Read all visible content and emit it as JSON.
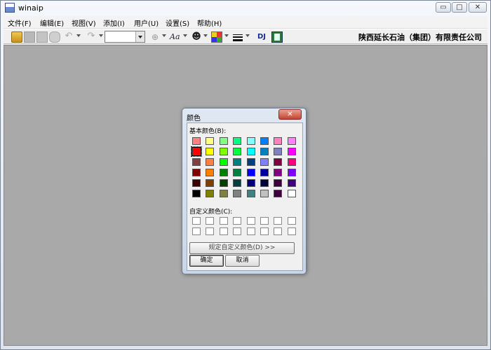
{
  "window": {
    "title": "winaip",
    "min_glyph": "▭",
    "max_glyph": "□",
    "close_glyph": "✕"
  },
  "menu": [
    {
      "label": "文件(F)"
    },
    {
      "label": "编辑(E)"
    },
    {
      "label": "视图(V)"
    },
    {
      "label": "添加(I)"
    },
    {
      "label": "用户(U)"
    },
    {
      "label": "设置(S)"
    },
    {
      "label": "帮助(H)"
    }
  ],
  "toolbar": {
    "icons": [
      "open-folder-icon",
      "save-icon",
      "print-icon",
      "find-icon",
      "undo-icon",
      "redo-icon",
      "target-icon",
      "font-icon",
      "person-icon",
      "color-grid-icon",
      "line-style-icon",
      "dj-icon",
      "document-icon"
    ],
    "undo_glyph": "↶",
    "redo_glyph": "↷",
    "target_glyph": "⊕",
    "font_text": "Aa",
    "person_glyph": "☻",
    "dj_label": "DJ",
    "combo_value": "",
    "company": "陕西延长石油（集团）有限责任公司"
  },
  "dialog": {
    "title": "颜色",
    "close_glyph": "✕",
    "basic_label": "基本颜色(B):",
    "custom_label": "自定义颜色(C):",
    "define_button": "规定自定义颜色(D) >>",
    "ok_button": "确定",
    "cancel_button": "取消",
    "selected_index": 8,
    "basic_colors": [
      "#ff8080",
      "#ffff80",
      "#80ff80",
      "#00ff80",
      "#80ffff",
      "#0080ff",
      "#ff80c0",
      "#ff80ff",
      "#ff0000",
      "#ffff00",
      "#80ff00",
      "#00ff40",
      "#00ffff",
      "#0080c0",
      "#8080c0",
      "#ff00ff",
      "#804040",
      "#ff8040",
      "#00ff00",
      "#008080",
      "#004080",
      "#8080ff",
      "#800040",
      "#ff0080",
      "#800000",
      "#ff8000",
      "#008000",
      "#008040",
      "#0000ff",
      "#0000a0",
      "#800080",
      "#8000ff",
      "#400000",
      "#804000",
      "#004000",
      "#004040",
      "#000080",
      "#000040",
      "#400040",
      "#400080",
      "#000000",
      "#808000",
      "#808040",
      "#808080",
      "#408080",
      "#c0c0c0",
      "#400040",
      "#ffffff"
    ],
    "custom_colors": [
      "#ffffff",
      "#ffffff",
      "#ffffff",
      "#ffffff",
      "#ffffff",
      "#ffffff",
      "#ffffff",
      "#ffffff",
      "#ffffff",
      "#ffffff",
      "#ffffff",
      "#ffffff",
      "#ffffff",
      "#ffffff",
      "#ffffff",
      "#ffffff"
    ]
  }
}
